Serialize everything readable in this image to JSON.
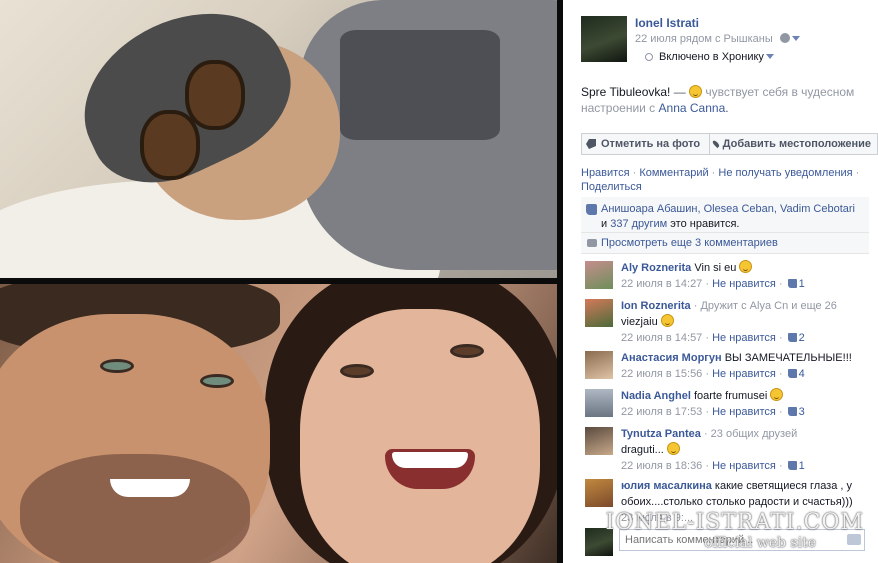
{
  "post": {
    "owner_name": "Ionel Istrati",
    "meta_text": "22 июля рядом с Рышканы",
    "timeline_label": "Включено в Хронику",
    "status": {
      "place": "Spre Tibuleovka!",
      "dash": " — ",
      "feeling": "чувствует себя в чудесном настроении с",
      "friend": "Anna Canna",
      "end": "."
    },
    "actions": {
      "tag_label": "Отметить на фото",
      "place_label": "Добавить местоположение"
    },
    "links": {
      "like": "Нравится",
      "comment": "Комментарий",
      "notify": "Не получать уведомления",
      "share": "Поделиться",
      "separator": " · "
    }
  },
  "likes": {
    "names": "Анишоара Абашин, Olesea Ceban, Vadim Cebotari",
    "and_word": " и ",
    "others": "337 другим",
    "suffix": " это нравится."
  },
  "more_comments": "Просмотреть еще 3 комментариев",
  "comments": [
    {
      "author": "Aly Roznerita",
      "text": "Vin si eu",
      "time": "22 июля в 14:27",
      "unlike": "Не нравится",
      "likes": "1"
    },
    {
      "author": "Ion Roznerita",
      "sub": "· Дружит с Alya Cn и еще 26",
      "text": "viezjaiu",
      "time": "22 июля в 14:57",
      "unlike": "Не нравится",
      "likes": "2"
    },
    {
      "author": "Анастасия Моргун",
      "text": "ВЫ ЗАМЕЧАТЕЛЬНЫЕ!!!",
      "time": "22 июля в 15:56",
      "unlike": "Не нравится",
      "likes": "4"
    },
    {
      "author": "Nadia Anghel",
      "text": "foarte frumusei",
      "time": "22 июля в 17:53",
      "unlike": "Не нравится",
      "likes": "3"
    },
    {
      "author": "Tynutza Pantea",
      "sub": "· 23 общих друзей",
      "text": "draguti...",
      "time": "22 июля в 18:36",
      "unlike": "Не нравится",
      "likes": "1"
    },
    {
      "author": "юлия масалкина",
      "text": "какие светящиеся глаза , у обоих....столько столько радости и счастья)))",
      "time": "23 июля в 9:..."
    }
  ],
  "comment_input": {
    "placeholder": "Написать комментарий..."
  },
  "watermark": {
    "title": "IONEL-ISTRATI.COM",
    "subtitle": "official web site"
  },
  "icons": [
    "globe-icon",
    "tag-icon",
    "location-pin-icon",
    "like-icon",
    "comment-bubble-icon",
    "thumbs-up-icon",
    "camera-icon",
    "smiley-icon"
  ],
  "colors": {
    "link": "#3b5998",
    "muted": "#9197a3",
    "panel_bg": "#ffffff",
    "ufi_bg": "#f6f7f8"
  }
}
